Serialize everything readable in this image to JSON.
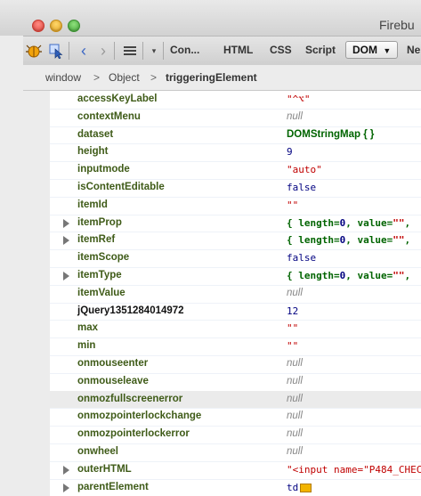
{
  "window": {
    "title": "Firebu"
  },
  "toolbar": {
    "tabs": [
      "Con...",
      "HTML",
      "CSS",
      "Script",
      "DOM",
      "Ne"
    ],
    "active_tab": "DOM",
    "dom_dropdown_icon": "caret-down-icon"
  },
  "breadcrumbs": [
    "window",
    "Object",
    "triggeringElement"
  ],
  "breadcrumb_separator": ">",
  "rows": [
    {
      "name": "accessKeyLabel",
      "value": "\"^⌥\"",
      "type": "string"
    },
    {
      "name": "contextMenu",
      "value": "null",
      "type": "null"
    },
    {
      "name": "dataset",
      "value": "DOMStringMap { }",
      "type": "object"
    },
    {
      "name": "height",
      "value": "9",
      "type": "number"
    },
    {
      "name": "inputmode",
      "value": "\"auto\"",
      "type": "string"
    },
    {
      "name": "isContentEditable",
      "value": "false",
      "type": "bool"
    },
    {
      "name": "itemId",
      "value": "\"\"",
      "type": "string"
    },
    {
      "name": "itemProp",
      "value": "{ length=0, value=\"\",",
      "type": "objarr",
      "expandable": true
    },
    {
      "name": "itemRef",
      "value": "{ length=0, value=\"\",",
      "type": "objarr",
      "expandable": true
    },
    {
      "name": "itemScope",
      "value": "false",
      "type": "bool"
    },
    {
      "name": "itemType",
      "value": "{ length=0, value=\"\",",
      "type": "objarr",
      "expandable": true
    },
    {
      "name": "itemValue",
      "value": "null",
      "type": "null"
    },
    {
      "name": "jQuery1351284014972",
      "value": "12",
      "type": "number",
      "user": true
    },
    {
      "name": "max",
      "value": "\"\"",
      "type": "string"
    },
    {
      "name": "min",
      "value": "\"\"",
      "type": "string"
    },
    {
      "name": "onmouseenter",
      "value": "null",
      "type": "null"
    },
    {
      "name": "onmouseleave",
      "value": "null",
      "type": "null"
    },
    {
      "name": "onmozfullscreenerror",
      "value": "null",
      "type": "null",
      "highlight": true
    },
    {
      "name": "onmozpointerlockchange",
      "value": "null",
      "type": "null"
    },
    {
      "name": "onmozpointerlockerror",
      "value": "null",
      "type": "null"
    },
    {
      "name": "onwheel",
      "value": "null",
      "type": "null"
    },
    {
      "name": "outerHTML",
      "value": "\"<input name=\"P484_CHEC",
      "type": "string",
      "expandable": true
    },
    {
      "name": "parentElement",
      "value": "td",
      "type": "element",
      "expandable": true
    }
  ],
  "colors": {
    "property_name": "#3f5b18",
    "string": "#c00000",
    "null": "#888888",
    "number": "#000080",
    "object": "#006400",
    "highlight_row": "#ebebeb"
  }
}
